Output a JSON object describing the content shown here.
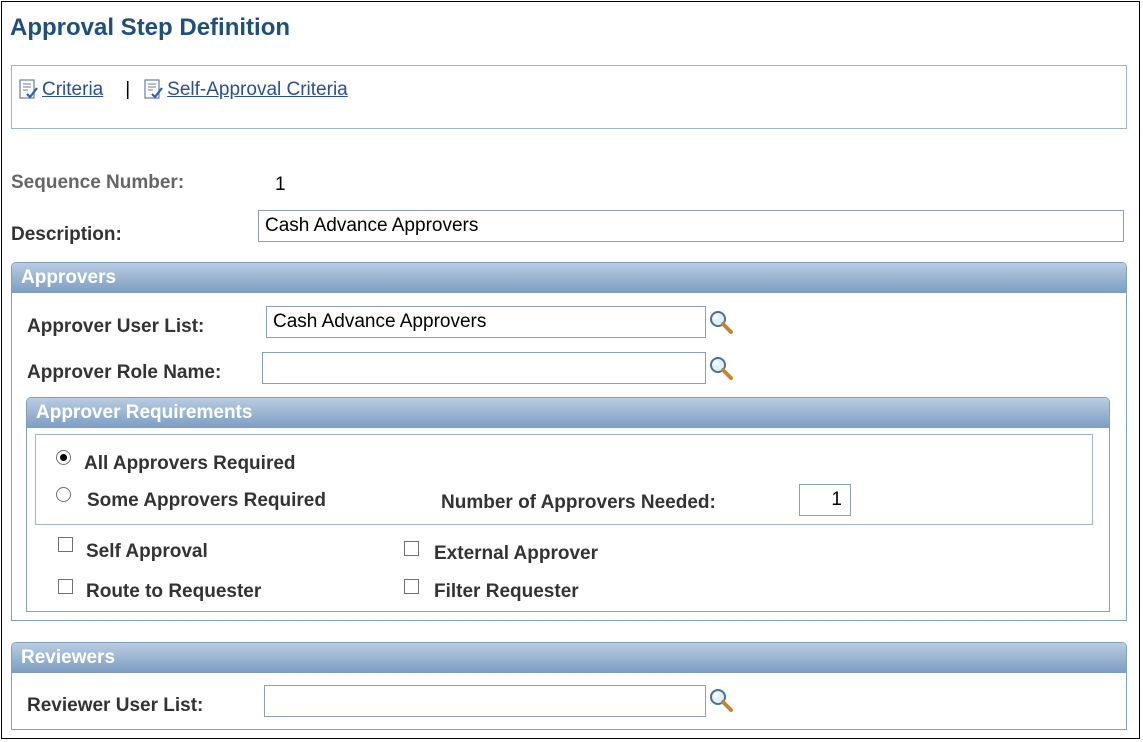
{
  "page": {
    "title": "Approval Step Definition"
  },
  "links": {
    "criteria": "Criteria",
    "separator": "|",
    "self_approval_criteria": "Self-Approval Criteria"
  },
  "fields": {
    "sequence_number_label": "Sequence Number:",
    "sequence_number_value": "1",
    "description_label": "Description:",
    "description_value": "Cash Advance Approvers"
  },
  "approvers": {
    "header": "Approvers",
    "user_list_label": "Approver User List:",
    "user_list_value": "Cash Advance Approvers",
    "role_name_label": "Approver Role Name:",
    "role_name_value": "",
    "requirements": {
      "header": "Approver Requirements",
      "all_required_label": "All Approvers Required",
      "all_required_selected": true,
      "some_required_label": "Some Approvers Required",
      "some_required_selected": false,
      "number_needed_label": "Number of Approvers Needed:",
      "number_needed_value": "1"
    },
    "options": {
      "self_approval": "Self Approval",
      "external_approver": "External Approver",
      "route_to_requester": "Route to Requester",
      "filter_requester": "Filter Requester"
    }
  },
  "reviewers": {
    "header": "Reviewers",
    "user_list_label": "Reviewer User List:",
    "user_list_value": ""
  },
  "icons": {
    "link_icon": "page-check-icon",
    "lookup_icon": "magnifier-icon"
  },
  "colors": {
    "title": "#1f4f7f",
    "link": "#2a4e9d",
    "group_header": "#7c9dc2"
  }
}
